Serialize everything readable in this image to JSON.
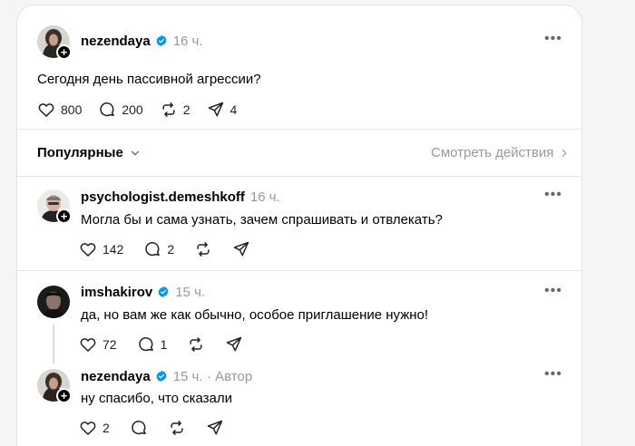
{
  "main_post": {
    "username": "nezendaya",
    "time": "16 ч.",
    "text": "Сегодня день пассивной агрессии?",
    "likes": "800",
    "replies": "200",
    "reposts": "2",
    "shares": "4"
  },
  "sort": {
    "label": "Популярные",
    "activity_link": "Смотреть действия"
  },
  "replies": [
    {
      "username": "psychologist.demeshkoff",
      "time": "16 ч.",
      "text": "Могла бы и сама узнать, зачем спрашивать и отвлекать?",
      "likes": "142",
      "replies": "2"
    },
    {
      "username": "imshakirov",
      "time": "15 ч.",
      "text": "да, но вам же как обычно, особое приглашение нужно!",
      "likes": "72",
      "replies": "1"
    },
    {
      "username": "nezendaya",
      "time": "15 ч.",
      "author_label": "· Автор",
      "text": "ну спасибо, что сказали",
      "likes": "2"
    }
  ],
  "icons": {
    "more": "more-horizontal-icon",
    "like": "heart-icon",
    "reply": "comment-bubble-icon",
    "repost": "repost-icon",
    "share": "send-icon",
    "verified": "verified-badge-icon",
    "follow": "plus-icon",
    "chevron": "chevron-down-icon",
    "arrow": "chevron-right-icon"
  },
  "colors": {
    "verified": "#0095f6",
    "muted": "#999999"
  }
}
